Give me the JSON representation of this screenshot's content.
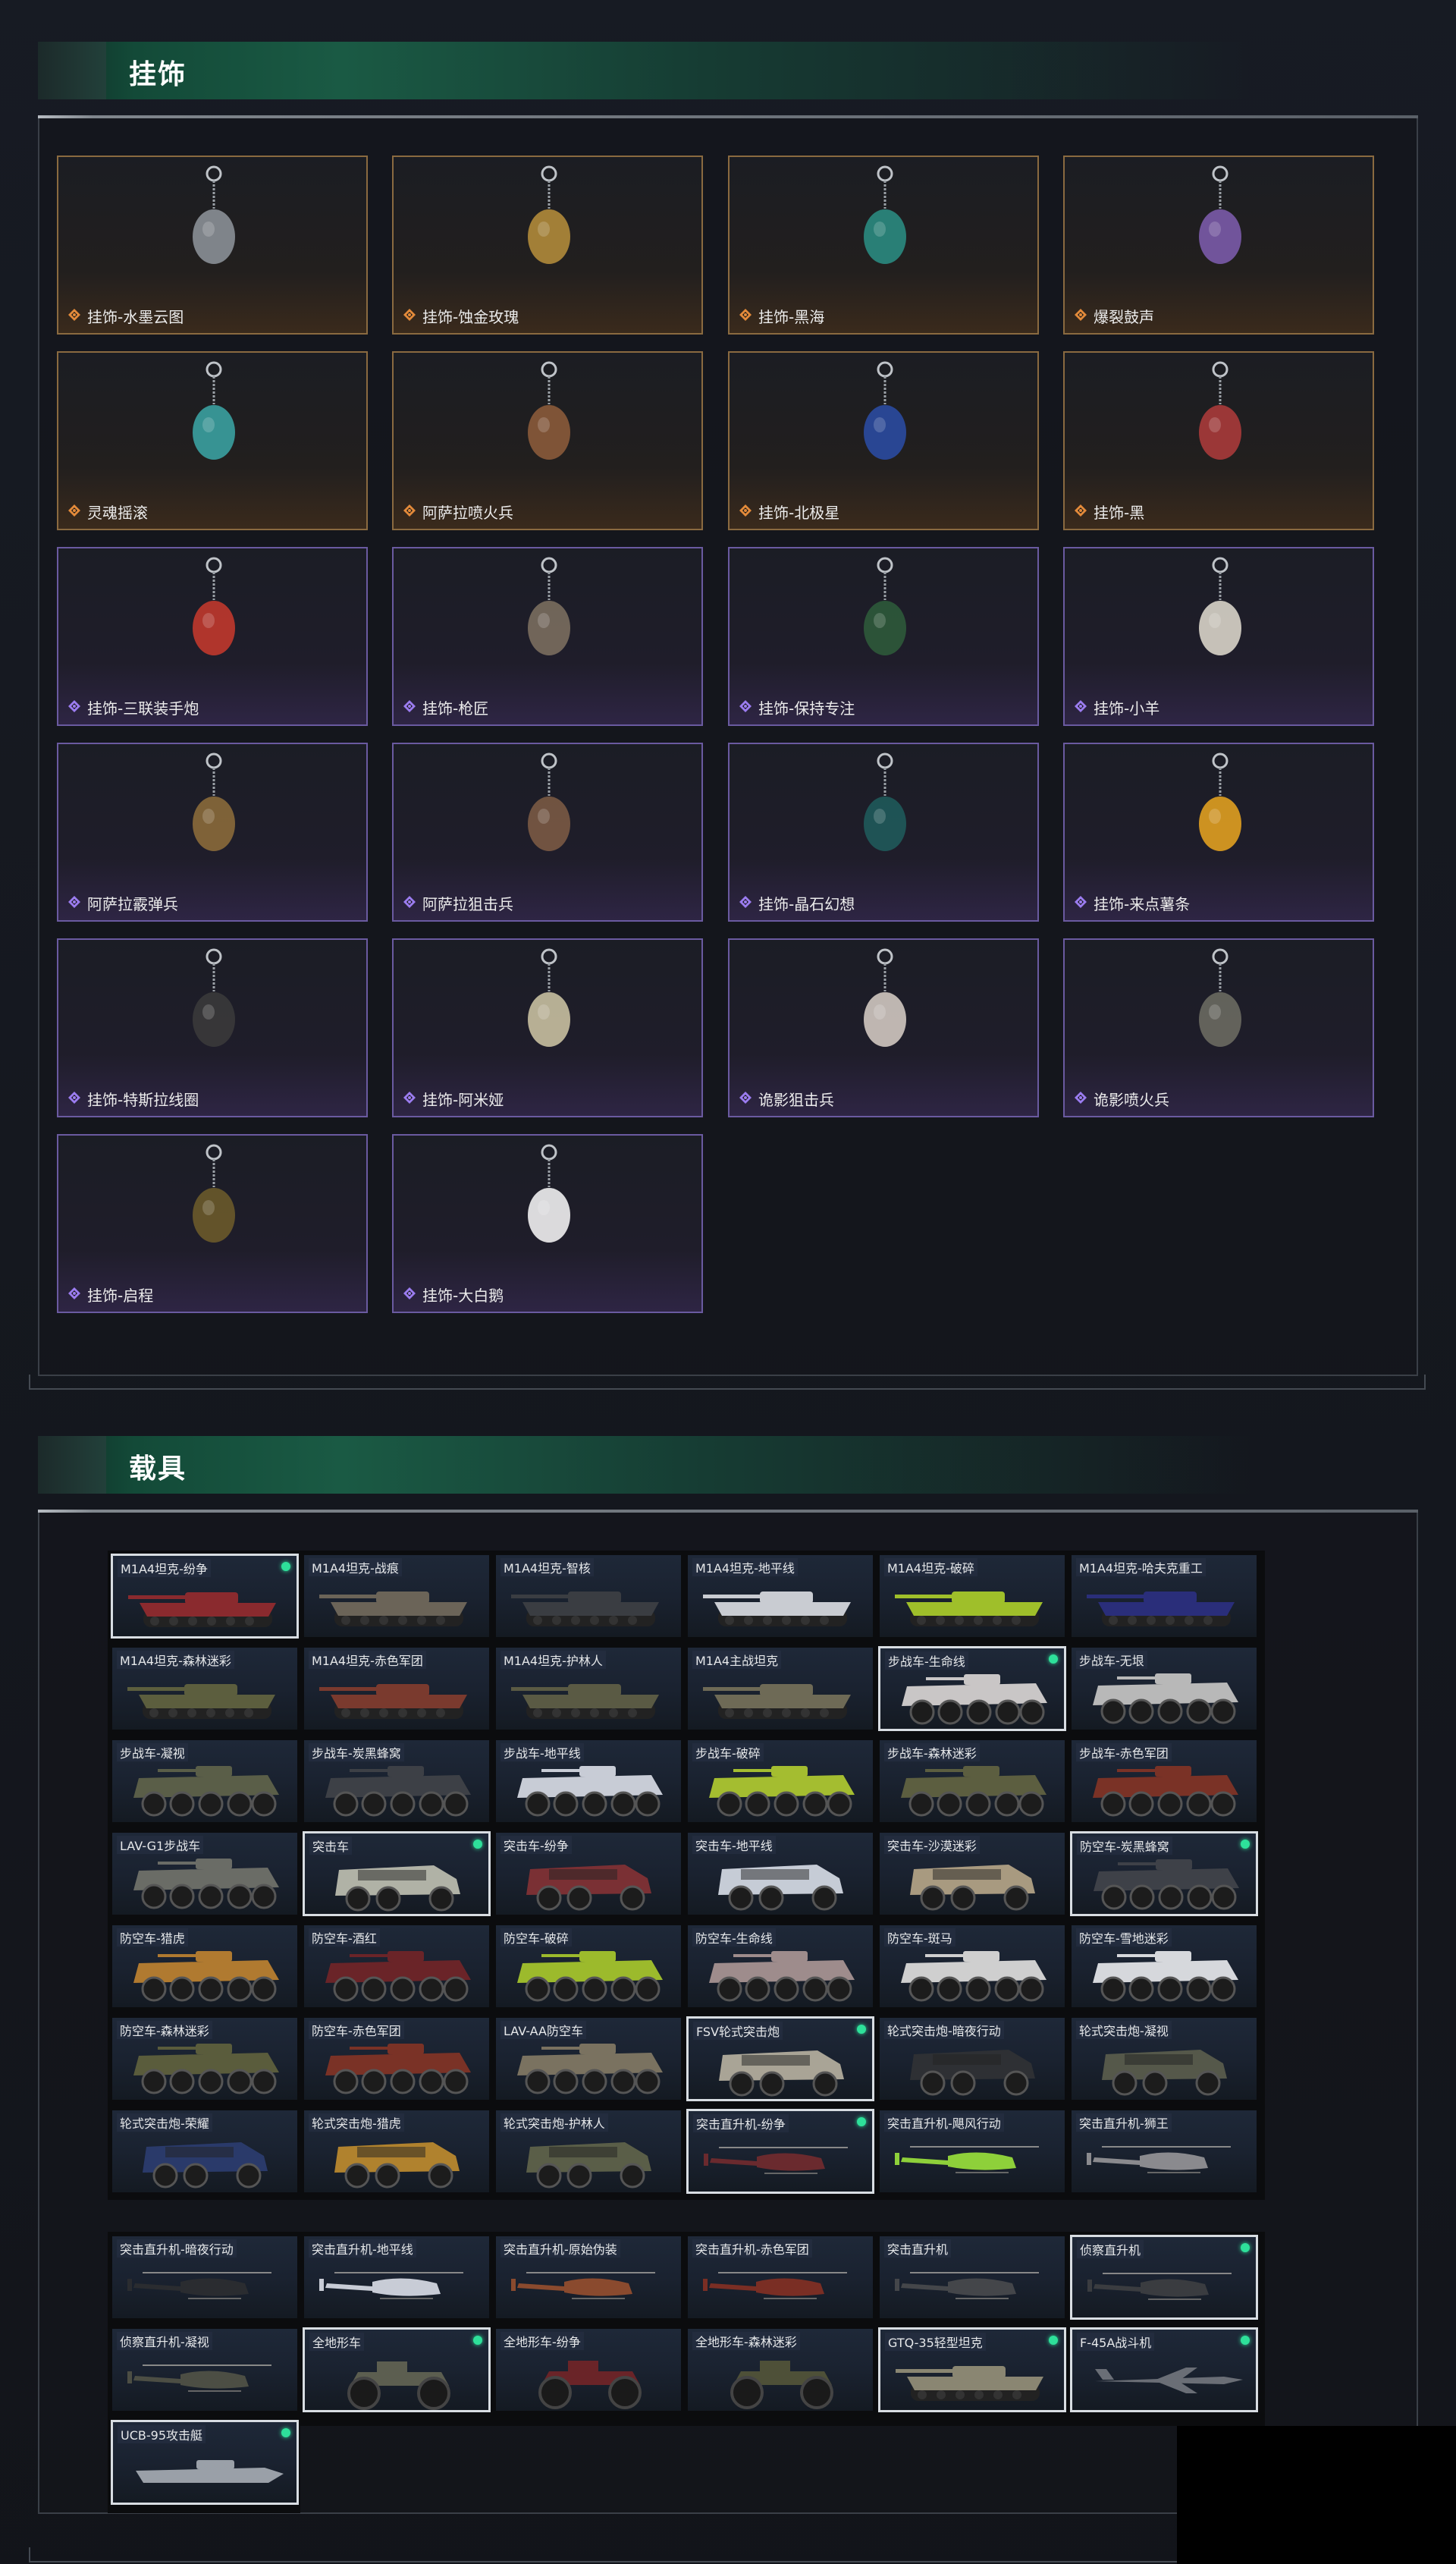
{
  "sections": {
    "pendants_title": "挂饰",
    "vehicles_title": "载具"
  },
  "colors": {
    "orange_rarity": "#e38a3a",
    "purple_rarity": "#9b7cf0",
    "header_green": "#1a5a44",
    "owned_dot": "#2ee09a"
  },
  "pendants": [
    {
      "label": "挂饰-水墨云图",
      "rarity": "orange",
      "icon": "ink-orb-charm"
    },
    {
      "label": "挂饰-蚀金玫瑰",
      "rarity": "orange",
      "icon": "gold-rose-charm"
    },
    {
      "label": "挂饰-黑海",
      "rarity": "orange",
      "icon": "anchor-charm"
    },
    {
      "label": "爆裂鼓声",
      "rarity": "orange",
      "icon": "drummer-figure-charm"
    },
    {
      "label": "灵魂摇滚",
      "rarity": "orange",
      "icon": "guitarist-figure-charm"
    },
    {
      "label": "阿萨拉喷火兵",
      "rarity": "orange",
      "icon": "flamethrower-soldier-charm"
    },
    {
      "label": "挂饰-北极星",
      "rarity": "orange",
      "icon": "north-star-charm"
    },
    {
      "label": "挂饰-黑",
      "rarity": "orange",
      "icon": "black-tag-charm"
    },
    {
      "label": "挂饰-三联装手炮",
      "rarity": "purple",
      "icon": "triple-cannon-charm"
    },
    {
      "label": "挂饰-枪匠",
      "rarity": "purple",
      "icon": "gunsmith-case-charm"
    },
    {
      "label": "挂饰-保持专注",
      "rarity": "purple",
      "icon": "stay-focused-sign-charm"
    },
    {
      "label": "挂饰-小羊",
      "rarity": "purple",
      "icon": "lamb-charm"
    },
    {
      "label": "阿萨拉霰弹兵",
      "rarity": "purple",
      "icon": "shotgun-soldier-charm"
    },
    {
      "label": "阿萨拉狙击兵",
      "rarity": "purple",
      "icon": "sniper-soldier-charm"
    },
    {
      "label": "挂饰-晶石幻想",
      "rarity": "purple",
      "icon": "crystal-cube-charm"
    },
    {
      "label": "挂饰-来点薯条",
      "rarity": "purple",
      "icon": "fries-charm"
    },
    {
      "label": "挂饰-特斯拉线圈",
      "rarity": "purple",
      "icon": "tesla-coil-charm"
    },
    {
      "label": "挂饰-阿米娅",
      "rarity": "purple",
      "icon": "bunny-charm"
    },
    {
      "label": "诡影狙击兵",
      "rarity": "purple",
      "icon": "ghost-sniper-charm"
    },
    {
      "label": "诡影喷火兵",
      "rarity": "purple",
      "icon": "ghost-flamer-charm"
    },
    {
      "label": "挂饰-启程",
      "rarity": "purple",
      "icon": "medal-charm"
    },
    {
      "label": "挂饰-大白鹅",
      "rarity": "purple",
      "icon": "goose-charm"
    }
  ],
  "vehicles_group1": [
    {
      "name": "M1A4坦克-纷争",
      "type": "tank",
      "owned": true,
      "selected": true,
      "color": "#8a2a2e"
    },
    {
      "name": "M1A4坦克-战痕",
      "type": "tank",
      "owned": false,
      "selected": false,
      "color": "#6b6458"
    },
    {
      "name": "M1A4坦克-智核",
      "type": "tank",
      "owned": false,
      "selected": false,
      "color": "#3a3d42"
    },
    {
      "name": "M1A4坦克-地平线",
      "type": "tank",
      "owned": false,
      "selected": false,
      "color": "#c9ccd2"
    },
    {
      "name": "M1A4坦克-破碎",
      "type": "tank",
      "owned": false,
      "selected": false,
      "color": "#9fbf2a"
    },
    {
      "name": "M1A4坦克-哈夫克重工",
      "type": "tank",
      "owned": false,
      "selected": false,
      "color": "#2a2e7a"
    },
    {
      "name": "M1A4坦克-森林迷彩",
      "type": "tank",
      "owned": false,
      "selected": false,
      "color": "#5c5e3e"
    },
    {
      "name": "M1A4坦克-赤色军团",
      "type": "tank",
      "owned": false,
      "selected": false,
      "color": "#7a3a2e"
    },
    {
      "name": "M1A4坦克-护林人",
      "type": "tank",
      "owned": false,
      "selected": false,
      "color": "#5a5a44"
    },
    {
      "name": "M1A4主战坦克",
      "type": "tank",
      "owned": false,
      "selected": false,
      "color": "#6e6a56"
    },
    {
      "name": "步战车-生命线",
      "type": "ifv",
      "owned": true,
      "selected": true,
      "color": "#c9c6c6"
    },
    {
      "name": "步战车-无垠",
      "type": "ifv",
      "owned": false,
      "selected": false,
      "color": "#b8b8b8"
    },
    {
      "name": "步战车-凝视",
      "type": "ifv",
      "owned": false,
      "selected": false,
      "color": "#5a5e48"
    },
    {
      "name": "步战车-炭黑蜂窝",
      "type": "ifv",
      "owned": false,
      "selected": false,
      "color": "#3d4046"
    },
    {
      "name": "步战车-地平线",
      "type": "ifv",
      "owned": false,
      "selected": false,
      "color": "#c8ccd6"
    },
    {
      "name": "步战车-破碎",
      "type": "ifv",
      "owned": false,
      "selected": false,
      "color": "#a4bd30"
    },
    {
      "name": "步战车-森林迷彩",
      "type": "ifv",
      "owned": false,
      "selected": false,
      "color": "#5c5e40"
    },
    {
      "name": "步战车-赤色军团",
      "type": "ifv",
      "owned": false,
      "selected": false,
      "color": "#7a3226"
    },
    {
      "name": "LAV-G1步战车",
      "type": "ifv",
      "owned": false,
      "selected": false,
      "color": "#6a6c66"
    },
    {
      "name": "突击车",
      "type": "jeep",
      "owned": true,
      "selected": true,
      "color": "#b0b2a6"
    },
    {
      "name": "突击车-纷争",
      "type": "jeep",
      "owned": false,
      "selected": false,
      "color": "#7a3034"
    },
    {
      "name": "突击车-地平线",
      "type": "jeep",
      "owned": false,
      "selected": false,
      "color": "#c6ccd6"
    },
    {
      "name": "突击车-沙漠迷彩",
      "type": "jeep",
      "owned": false,
      "selected": false,
      "color": "#a89a80"
    },
    {
      "name": "防空车-炭黑蜂窝",
      "type": "ifv",
      "owned": true,
      "selected": true,
      "color": "#3e4148"
    },
    {
      "name": "防空车-猎虎",
      "type": "ifv",
      "owned": false,
      "selected": false,
      "color": "#b07a30"
    },
    {
      "name": "防空车-酒红",
      "type": "ifv",
      "owned": false,
      "selected": false,
      "color": "#6a2428"
    },
    {
      "name": "防空车-破碎",
      "type": "ifv",
      "owned": false,
      "selected": false,
      "color": "#9cba2c"
    },
    {
      "name": "防空车-生命线",
      "type": "ifv",
      "owned": false,
      "selected": false,
      "color": "#9e8c8c"
    },
    {
      "name": "防空车-斑马",
      "type": "ifv",
      "owned": false,
      "selected": false,
      "color": "#cfcfcf"
    },
    {
      "name": "防空车-雪地迷彩",
      "type": "ifv",
      "owned": false,
      "selected": false,
      "color": "#d6d8dc"
    },
    {
      "name": "防空车-森林迷彩",
      "type": "ifv",
      "owned": false,
      "selected": false,
      "color": "#5a5c3c"
    },
    {
      "name": "防空车-赤色军团",
      "type": "ifv",
      "owned": false,
      "selected": false,
      "color": "#7a3226"
    },
    {
      "name": "LAV-AA防空车",
      "type": "ifv",
      "owned": false,
      "selected": false,
      "color": "#7a7260"
    },
    {
      "name": "FSV轮式突击炮",
      "type": "jeep",
      "owned": true,
      "selected": true,
      "color": "#a9a496"
    },
    {
      "name": "轮式突击炮-暗夜行动",
      "type": "jeep",
      "owned": false,
      "selected": false,
      "color": "#2e3034"
    },
    {
      "name": "轮式突击炮-凝视",
      "type": "jeep",
      "owned": false,
      "selected": false,
      "color": "#55584a"
    },
    {
      "name": "轮式突击炮-荣耀",
      "type": "jeep",
      "owned": false,
      "selected": false,
      "color": "#2a3a6a"
    },
    {
      "name": "轮式突击炮-猎虎",
      "type": "jeep",
      "owned": false,
      "selected": false,
      "color": "#b0822e"
    },
    {
      "name": "轮式突击炮-护林人",
      "type": "jeep",
      "owned": false,
      "selected": false,
      "color": "#5a5e48"
    },
    {
      "name": "突击直升机-纷争",
      "type": "heli",
      "owned": true,
      "selected": true,
      "color": "#6a2a2e"
    },
    {
      "name": "突击直升机-飓风行动",
      "type": "heli",
      "owned": false,
      "selected": false,
      "color": "#8ed03a"
    },
    {
      "name": "突击直升机-狮王",
      "type": "heli",
      "owned": false,
      "selected": false,
      "color": "#8a8a8e"
    }
  ],
  "vehicles_group2": [
    {
      "name": "突击直升机-暗夜行动",
      "type": "heli",
      "owned": false,
      "selected": false,
      "color": "#2a2c30"
    },
    {
      "name": "突击直升机-地平线",
      "type": "heli",
      "owned": false,
      "selected": false,
      "color": "#c8ccd6"
    },
    {
      "name": "突击直升机-原始伪装",
      "type": "heli",
      "owned": false,
      "selected": false,
      "color": "#8a4a2e"
    },
    {
      "name": "突击直升机-赤色军团",
      "type": "heli",
      "owned": false,
      "selected": false,
      "color": "#7a2e24"
    },
    {
      "name": "突击直升机",
      "type": "heli",
      "owned": false,
      "selected": false,
      "color": "#44464a"
    },
    {
      "name": "侦察直升机",
      "type": "heli",
      "owned": true,
      "selected": true,
      "color": "#3a3c40"
    },
    {
      "name": "侦察直升机-凝视",
      "type": "heli",
      "owned": false,
      "selected": false,
      "color": "#4c4e44"
    },
    {
      "name": "全地形车",
      "type": "atv",
      "owned": true,
      "selected": true,
      "color": "#5c5e50"
    },
    {
      "name": "全地形车-纷争",
      "type": "atv",
      "owned": false,
      "selected": false,
      "color": "#6a2428"
    },
    {
      "name": "全地形车-森林迷彩",
      "type": "atv",
      "owned": false,
      "selected": false,
      "color": "#4e5038"
    },
    {
      "name": "GTQ-35轻型坦克",
      "type": "tank",
      "owned": true,
      "selected": true,
      "color": "#8a8672"
    },
    {
      "name": "F-45A战斗机",
      "type": "jet",
      "owned": true,
      "selected": true,
      "color": "#6a6e76"
    },
    {
      "name": "UCB-95攻击艇",
      "type": "boat",
      "owned": true,
      "selected": true,
      "color": "#9aa0a8"
    }
  ]
}
